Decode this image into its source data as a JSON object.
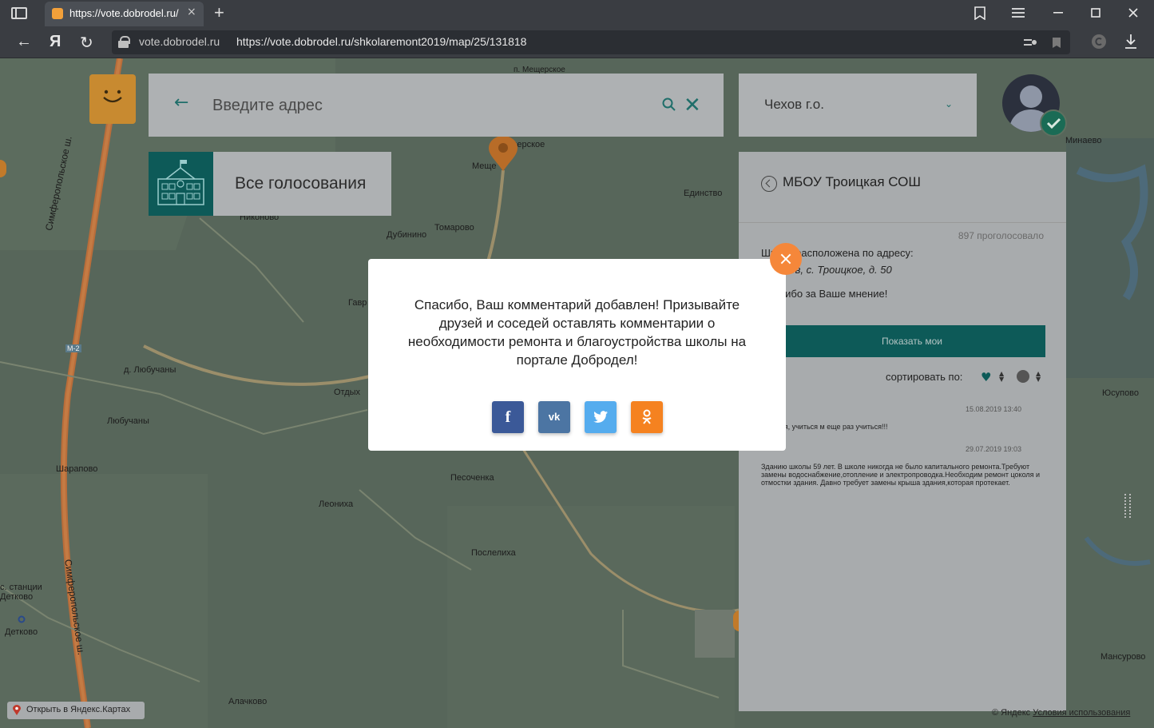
{
  "browser": {
    "tab_title": "https://vote.dobrodel.ru/",
    "tab_close": "×",
    "new_tab": "+",
    "url_domain": "vote.dobrodel.ru",
    "url_full": "https://vote.dobrodel.ru/shkolaremont2019/map/25/131818",
    "back": "←",
    "yandex": "Я",
    "reload": "↻"
  },
  "search": {
    "back_arrow": "←",
    "placeholder": "Введите адрес",
    "clear": "✕"
  },
  "region": {
    "value": "Чехов г.о.",
    "chevron": "⌄"
  },
  "votes_button": {
    "label": "Все голосования"
  },
  "school": {
    "title": "МБОУ Троицкая СОШ",
    "voted": "897 проголосовало",
    "address_label": "Школа расположена по адресу:",
    "address_value": "г. Чехов, с. Троицкое, д. 50",
    "thanks": "Спасибо за Ваше мнение!",
    "show_mine": "Показать мои",
    "sort_label": "сортировать по:",
    "comments": [
      {
        "date": "15.08.2019 13:40",
        "text": "Учиться, учиться м еще раз учиться!!!"
      },
      {
        "date": "29.07.2019 19:03",
        "text": "Зданию школы 59 лет. В школе никогда не было капитального ремонта.Требуют замены водоснабжение,отопление и электропроводка.Необходим ремонт цоколя и отмостки здания. Давно требует замены крыша здания,которая протекает."
      }
    ]
  },
  "map": {
    "labels": [
      {
        "text": "п. Мещерское"
      },
      {
        "text": "Мещерское"
      },
      {
        "text": "Меще"
      },
      {
        "text": "Единство"
      },
      {
        "text": "Минаево"
      },
      {
        "text": "Никоново"
      },
      {
        "text": "Дубинино"
      },
      {
        "text": "Томарово"
      },
      {
        "text": "Гавр"
      },
      {
        "text": "д. Любучаны"
      },
      {
        "text": "Любучаны"
      },
      {
        "text": "Отдых"
      },
      {
        "text": "Шарапово"
      },
      {
        "text": "Песоченка"
      },
      {
        "text": "Леониха"
      },
      {
        "text": "Послелиха"
      },
      {
        "text": "с. станции"
      },
      {
        "text": "Детково"
      },
      {
        "text": "Детково"
      },
      {
        "text": "Алачково"
      },
      {
        "text": "Юсупово"
      },
      {
        "text": "Мансурово"
      },
      {
        "text": "М-2"
      }
    ],
    "roads": [
      "Симферопольское ш.",
      "Симферопольское ш."
    ],
    "open_in_yandex": "Открыть в Яндекс.Картах",
    "copyright": "© Яндекс",
    "terms": "Условия использования"
  },
  "modal": {
    "message": "Спасибо, Ваш комментарий добавлен! Призывайте друзей и соседей оставлять комментарии о необходимости ремонта и благоустройства школы на портале Добродел!",
    "share": [
      {
        "network": "facebook",
        "glyph": "f",
        "color": "#3b5998"
      },
      {
        "network": "vk",
        "glyph": "vk",
        "color": "#4c75a3"
      },
      {
        "network": "twitter",
        "glyph": "🐦",
        "color": "#55acee"
      },
      {
        "network": "odnoklassniki",
        "glyph": "ok",
        "color": "#f58220"
      }
    ]
  },
  "colors": {
    "accent": "#0d5a58",
    "close_orange": "#f5873a",
    "brand_orange": "#f2a03a"
  }
}
